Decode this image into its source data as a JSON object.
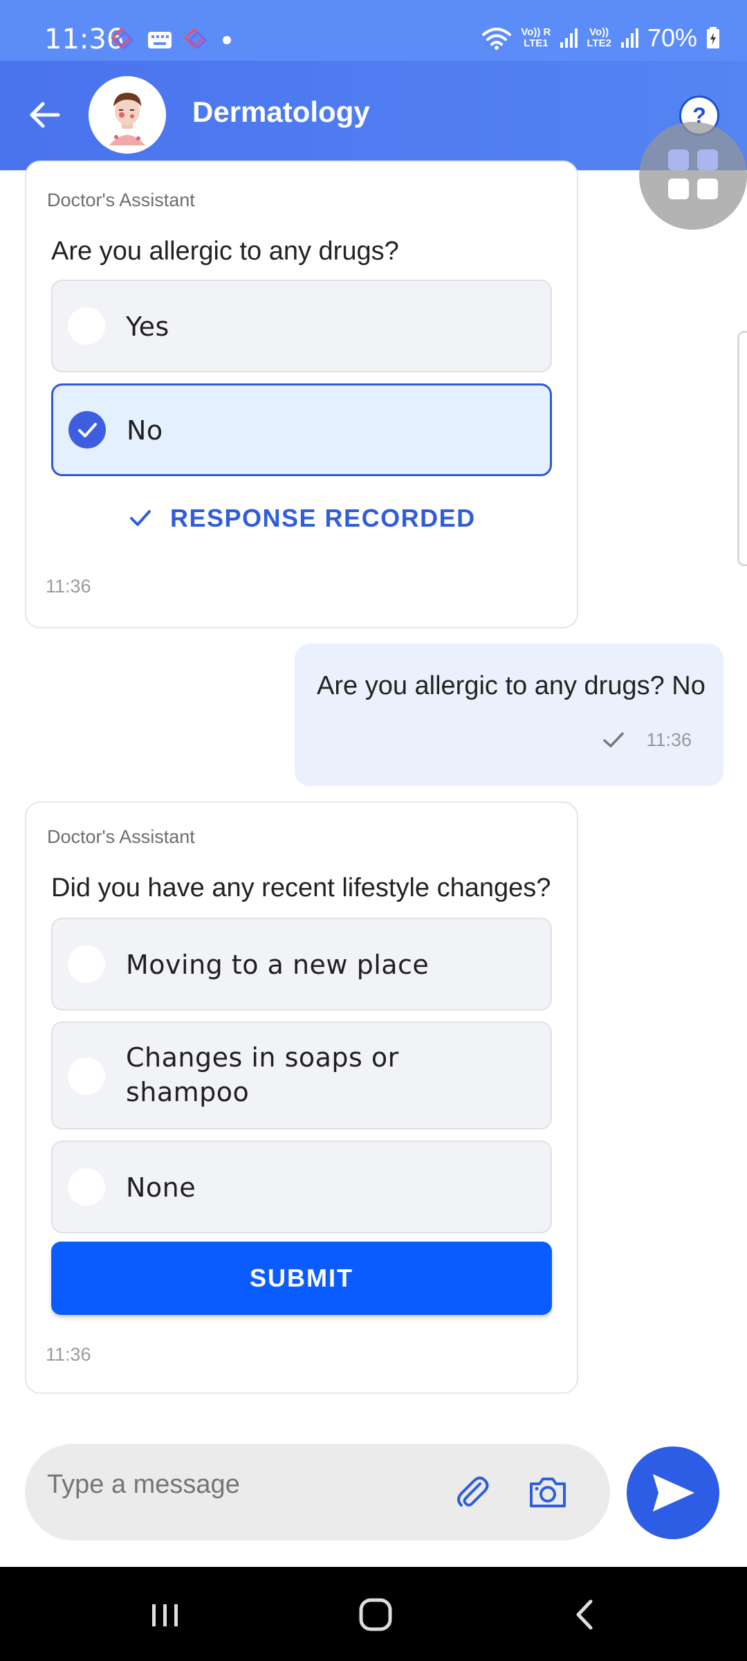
{
  "status_bar": {
    "time": "11:36",
    "battery": "70%",
    "net1_top": "Vo)) R",
    "net1_bottom": "LTE1",
    "net2_top": "Vo))",
    "net2_bottom": "LTE2"
  },
  "header": {
    "title": "Dermatology",
    "help_label": "?"
  },
  "card1": {
    "sender": "Doctor's Assistant",
    "question": "Are you allergic to any drugs?",
    "options": [
      {
        "label": "Yes",
        "selected": false
      },
      {
        "label": "No",
        "selected": true
      }
    ],
    "recorded_label": "RESPONSE RECORDED",
    "time": "11:36"
  },
  "user_message": {
    "text": "Are you allergic to any drugs? No",
    "time": "11:36"
  },
  "card2": {
    "sender": "Doctor's Assistant",
    "question": "Did you have any recent lifestyle changes?",
    "options": [
      {
        "label": "Moving to a new place",
        "selected": false
      },
      {
        "label_line1": "Changes in soaps or",
        "label_line2": "shampoo",
        "selected": false
      },
      {
        "label": "None",
        "selected": false
      }
    ],
    "submit_label": "SUBMIT",
    "time": "11:36"
  },
  "composer": {
    "placeholder": "Type a message"
  },
  "colors": {
    "header": "#4a73ee",
    "accent": "#2f5ddb",
    "submit": "#0b5cff",
    "selected_option_bg": "#e5f0ff"
  },
  "icons": {
    "back": "arrow-left-icon",
    "help": "question-icon",
    "attach": "paperclip-icon",
    "camera": "camera-icon",
    "send": "send-icon"
  }
}
